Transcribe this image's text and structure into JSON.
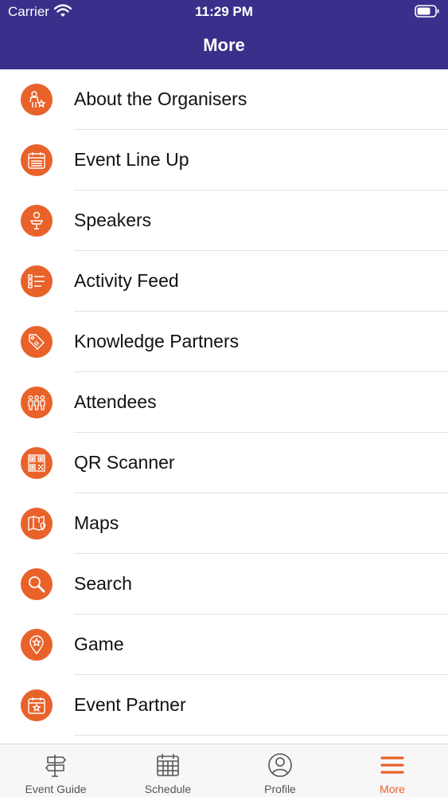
{
  "status_bar": {
    "carrier": "Carrier",
    "time": "11:29 PM"
  },
  "header": {
    "title": "More"
  },
  "menu": {
    "items": [
      {
        "label": "About the Organisers",
        "icon": "organiser-icon"
      },
      {
        "label": "Event Line Up",
        "icon": "calendar-list-icon"
      },
      {
        "label": "Speakers",
        "icon": "speaker-icon"
      },
      {
        "label": "Activity Feed",
        "icon": "feed-list-icon"
      },
      {
        "label": "Knowledge Partners",
        "icon": "tag-icon"
      },
      {
        "label": "Attendees",
        "icon": "people-icon"
      },
      {
        "label": "QR Scanner",
        "icon": "qr-code-icon"
      },
      {
        "label": "Maps",
        "icon": "map-icon"
      },
      {
        "label": "Search",
        "icon": "search-icon"
      },
      {
        "label": "Game",
        "icon": "game-star-pin-icon"
      },
      {
        "label": "Event Partner",
        "icon": "calendar-star-icon"
      }
    ]
  },
  "tab_bar": {
    "tabs": [
      {
        "label": "Event Guide",
        "icon": "signpost-icon",
        "active": false
      },
      {
        "label": "Schedule",
        "icon": "calendar-grid-icon",
        "active": false
      },
      {
        "label": "Profile",
        "icon": "user-circle-icon",
        "active": false
      },
      {
        "label": "More",
        "icon": "hamburger-menu-icon",
        "active": true
      }
    ]
  },
  "colors": {
    "header_bg": "#3a2f8a",
    "accent": "#e8622a",
    "text": "#111111",
    "inactive_tab": "#555555"
  }
}
